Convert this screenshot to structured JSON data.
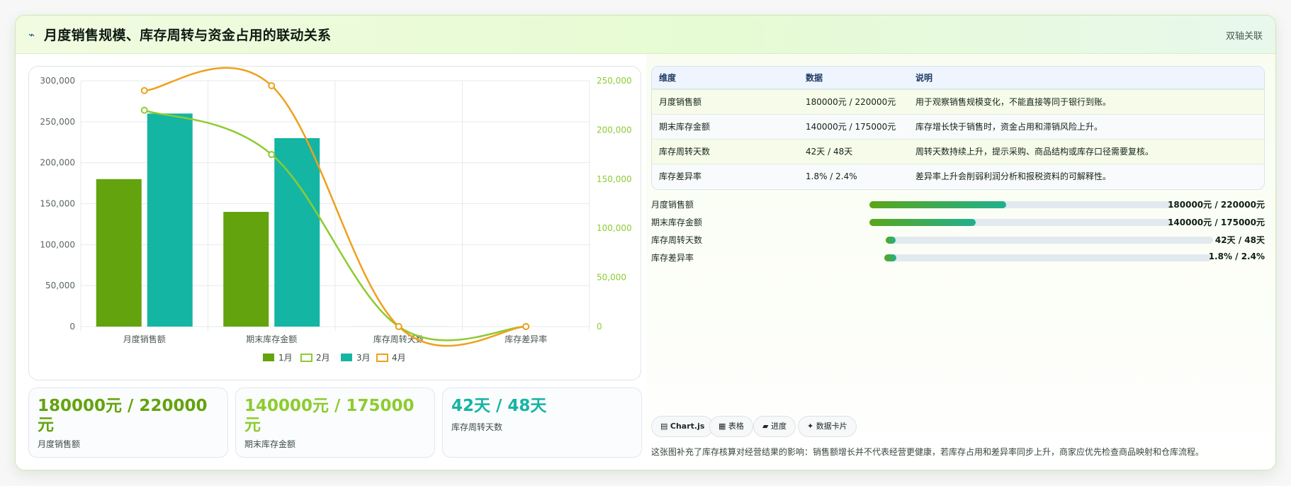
{
  "header": {
    "icon": "trend-icon",
    "title": "月度销售规模、库存周转与资金占用的联动关系",
    "tag": "双轴关联"
  },
  "colors": {
    "jan": "#63a30e",
    "feb": "#8ccc2f",
    "mar": "#15b5a3",
    "apr": "#efa01d"
  },
  "chart_data": {
    "type": "bar",
    "categories": [
      "月度销售额",
      "期末库存金额",
      "库存周转天数",
      "库存差异率"
    ],
    "series": [
      {
        "name": "1月",
        "kind": "bar",
        "axis": "left",
        "values": [
          180000,
          140000,
          42,
          1.8
        ]
      },
      {
        "name": "2月",
        "kind": "line",
        "axis": "right",
        "values": [
          220000,
          175000,
          48,
          2.4
        ]
      },
      {
        "name": "3月",
        "kind": "bar",
        "axis": "left",
        "values": [
          260000,
          230000,
          45,
          2.1
        ]
      },
      {
        "name": "4月",
        "kind": "line",
        "axis": "right",
        "values": [
          240000,
          245000,
          50,
          2.6
        ]
      }
    ],
    "y_left": {
      "min": 0,
      "max": 300000,
      "ticks": [
        "0",
        "50,000",
        "100,000",
        "150,000",
        "200,000",
        "250,000",
        "300,000"
      ]
    },
    "y_right": {
      "min": 0,
      "max": 250000,
      "ticks": [
        "0",
        "50,000",
        "100,000",
        "150,000",
        "200,000",
        "250,000"
      ]
    },
    "grid": true,
    "legend": "bottom"
  },
  "stats": [
    {
      "value": "180000元 / 220000元",
      "label": "月度销售额"
    },
    {
      "value": "140000元 / 175000元",
      "label": "期末库存金额"
    },
    {
      "value": "42天 / 48天",
      "label": "库存周转天数"
    }
  ],
  "table": {
    "headers": [
      "维度",
      "数据",
      "说明"
    ],
    "rows": [
      [
        "月度销售额",
        "180000元 / 220000元",
        "用于观察销售规模变化，不能直接等同于银行到账。"
      ],
      [
        "期末库存金额",
        "140000元 / 175000元",
        "库存增长快于销售时，资金占用和滞销风险上升。"
      ],
      [
        "库存周转天数",
        "42天 / 48天",
        "周转天数持续上升，提示采购、商品结构或库存口径需要复核。"
      ],
      [
        "库存差异率",
        "1.8% / 2.4%",
        "差异率上升会削弱利润分析和报税资料的可解释性。"
      ]
    ]
  },
  "progress": [
    {
      "label": "月度销售额",
      "value": "180000元 / 220000元",
      "fraction": 0.45
    },
    {
      "label": "期末库存金额",
      "value": "140000元 / 175000元",
      "fraction": 0.35
    },
    {
      "label": "库存周转天数",
      "value": "42天 / 48天",
      "fraction": 0.03
    },
    {
      "label": "库存差异率",
      "value": "1.8% / 2.4%",
      "fraction": 0.037
    }
  ],
  "chips": [
    {
      "icon": "chart-icon",
      "label": "Chart.js"
    },
    {
      "icon": "table-icon",
      "label": "表格"
    },
    {
      "icon": "progress-icon",
      "label": "进度"
    },
    {
      "icon": "card-icon",
      "label": "数据卡片"
    }
  ],
  "footnote": "这张图补充了库存核算对经营结果的影响：销售额增长并不代表经营更健康，若库存占用和差异率同步上升，商家应优先检查商品映射和仓库流程。"
}
